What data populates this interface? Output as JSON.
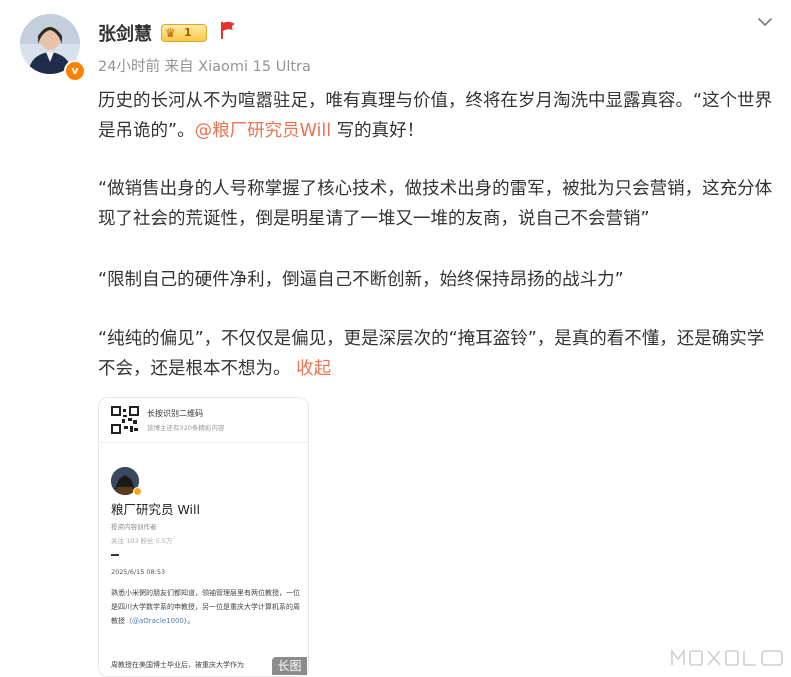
{
  "author": {
    "name": "张剑慧",
    "level": "1",
    "time": "24小时前",
    "source": "来自 Xiaomi 15 Ultra",
    "verified_mark": "v"
  },
  "post": {
    "p1_text": "历史的长河从不为喧嚣驻足，唯有真理与价值，终将在岁月淘洗中显露真容。“这个世界是吊诡的”。",
    "mention": "@粮厂研究员Will",
    "p1_tail": " 写的真好！",
    "p2": "“做销售出身的人号称掌握了核心技术，做技术出身的雷军，被批为只会营销，这充分体现了社会的荒诞性，倒是明星请了一堆又一堆的友商，说自己不会营销”",
    "p3": "“限制自己的硬件净利，倒逼自己不断创新，始终保持昂扬的战斗力”",
    "p4": "“纯纯的偏见”，不仅仅是偏见，更是深层次的“掩耳盗铃”，是真的看不懂，还是确实学不会，还是根本不想为。",
    "collapse": "收起"
  },
  "card": {
    "qr_title": "长按识别二维码",
    "qr_sub": "该博主还有320条精彩内容",
    "name": "粮厂研究员 Will",
    "role": "投资内容创作者",
    "stats": "关注 103  粉丝 5.5万",
    "date": "2025/6/15 08:53",
    "text_a": "熟悉小米粥的朋友们都知道，领袖管理层里有两位教授，一位是四川大学数学系的申教授，另一位是重庆大学计算机系的周教授（",
    "text_link": "@aOracle1000",
    "text_b": "）。",
    "tail": "周教授在美国博士毕业后，被重庆大学作为",
    "long_badge": "长图"
  },
  "icons": {
    "more": "chevron-down-icon",
    "flag": "flag-icon",
    "crown": "crown-icon"
  },
  "colors": {
    "link": "#eb7350",
    "meta": "#939393",
    "orange": "#ff8200"
  }
}
